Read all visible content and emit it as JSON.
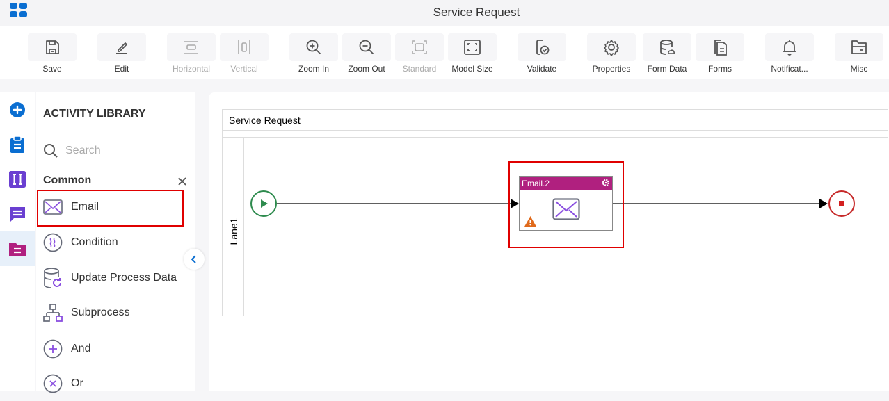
{
  "app": {
    "title": "Service Request",
    "icon": "app-grid-icon",
    "brand_color": "#0a6ed1"
  },
  "toolbar": {
    "buttons": [
      {
        "label": "Save",
        "icon": "save-icon",
        "enabled": true
      },
      {
        "label": "Edit",
        "icon": "edit-icon",
        "enabled": true
      },
      {
        "label": "Horizontal",
        "icon": "horizontal-icon",
        "enabled": false
      },
      {
        "label": "Vertical",
        "icon": "vertical-icon",
        "enabled": false
      },
      {
        "label": "Zoom In",
        "icon": "zoom-in-icon",
        "enabled": true
      },
      {
        "label": "Zoom Out",
        "icon": "zoom-out-icon",
        "enabled": true
      },
      {
        "label": "Standard",
        "icon": "standard-icon",
        "enabled": false
      },
      {
        "label": "Model Size",
        "icon": "model-size-icon",
        "enabled": true
      },
      {
        "label": "Validate",
        "icon": "validate-icon",
        "enabled": true
      },
      {
        "label": "Properties",
        "icon": "gear-icon",
        "enabled": true
      },
      {
        "label": "Form Data",
        "icon": "form-data-icon",
        "enabled": true
      },
      {
        "label": "Forms",
        "icon": "forms-icon",
        "enabled": true
      },
      {
        "label": "Notificat...",
        "icon": "bell-icon",
        "enabled": true
      },
      {
        "label": "Misc",
        "icon": "folder-icon",
        "enabled": true
      }
    ]
  },
  "rail": {
    "items": [
      {
        "name": "add",
        "icon": "plus-circle-icon",
        "color": "#0a6ed1"
      },
      {
        "name": "tasks",
        "icon": "clipboard-icon",
        "color": "#0a6ed1"
      },
      {
        "name": "variables",
        "icon": "variable-icon",
        "color": "#6a3fd1"
      },
      {
        "name": "messages",
        "icon": "chat-icon",
        "color": "#6a3fd1"
      },
      {
        "name": "library",
        "icon": "folder-doc-icon",
        "color": "#b0207f",
        "active": true
      }
    ]
  },
  "library": {
    "heading": "ACTIVITY LIBRARY",
    "search_placeholder": "Search",
    "category": "Common",
    "items": [
      {
        "label": "Email",
        "icon": "email-icon",
        "highlighted": true
      },
      {
        "label": "Condition",
        "icon": "condition-icon"
      },
      {
        "label": "Update Process Data",
        "icon": "update-data-icon"
      },
      {
        "label": "Subprocess",
        "icon": "subprocess-icon"
      },
      {
        "label": "And",
        "icon": "and-gateway-icon"
      },
      {
        "label": "Or",
        "icon": "or-gateway-icon"
      }
    ]
  },
  "canvas": {
    "pool_title": "Service Request",
    "lane_label": "Lane1",
    "task": {
      "label": "Email.2",
      "header_color": "#b0207f",
      "warning": true,
      "highlighted": true
    },
    "start_event_color": "#2e8b4e",
    "end_event_color": "#c62828"
  }
}
